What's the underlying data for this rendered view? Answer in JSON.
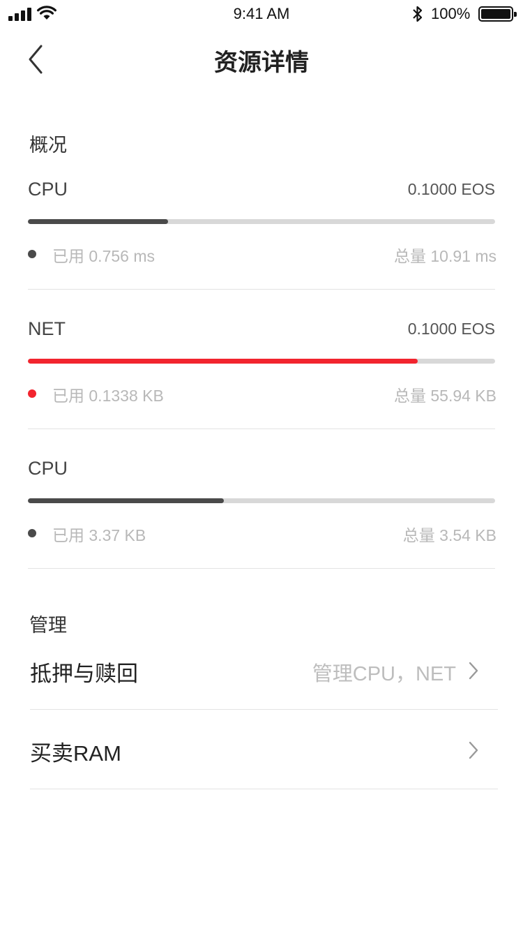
{
  "status_bar": {
    "time": "9:41 AM",
    "battery": "100%",
    "icons": [
      "signal-icon",
      "wifi-icon",
      "bluetooth-icon",
      "battery-icon"
    ]
  },
  "nav": {
    "title": "资源详情",
    "back_icon": "chevron-left-icon"
  },
  "overview": {
    "title": "概况",
    "resources": [
      {
        "name": "CPU",
        "price": "0.1000 EOS",
        "used": "已用 0.756 ms",
        "total": "总量 10.91 ms",
        "usage_fraction": 0.3,
        "color": "#4a4a4a"
      },
      {
        "name": "NET",
        "price": "0.1000 EOS",
        "used": "已用 0.1338 KB",
        "total": "总量 55.94 KB",
        "usage_fraction": 0.835,
        "color": "#f2242e"
      },
      {
        "name": "CPU",
        "price": "",
        "used": "已用 3.37 KB",
        "total": "总量 3.54 KB",
        "usage_fraction": 0.42,
        "color": "#4a4a4a"
      }
    ]
  },
  "management": {
    "title": "管理",
    "items": [
      {
        "label": "抵押与赎回",
        "value": "管理CPU，NET",
        "icon": "chevron-right-icon"
      },
      {
        "label": "买卖RAM",
        "value": "",
        "icon": "chevron-right-icon"
      }
    ]
  },
  "colors": {
    "accent": "#f2242e",
    "bar_track": "#d8d8d8",
    "bar_default": "#4a4a4a"
  }
}
